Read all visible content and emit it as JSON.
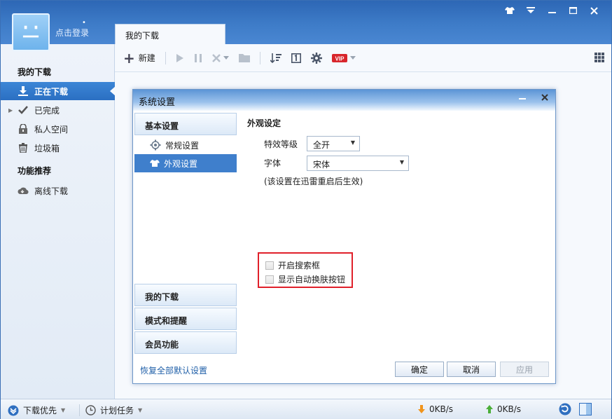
{
  "header": {
    "login_text": "点击登录",
    "tab_label": "我的下载",
    "window_controls": [
      "skin-icon",
      "menu-icon",
      "minimize-icon",
      "maximize-icon",
      "close-icon"
    ]
  },
  "sidebar": {
    "section1": "我的下载",
    "items": [
      {
        "label": "正在下载",
        "icon": "download-icon",
        "active": true
      },
      {
        "label": "已完成",
        "icon": "check-icon"
      },
      {
        "label": "私人空间",
        "icon": "lock-icon"
      },
      {
        "label": "垃圾箱",
        "icon": "trash-icon"
      }
    ],
    "section2": "功能推荐",
    "items2": [
      {
        "label": "离线下载",
        "icon": "cloud-icon"
      }
    ]
  },
  "toolbar": {
    "new_label": "新建"
  },
  "dialog": {
    "title": "系统设置",
    "categories": {
      "basic": "基本设置",
      "sub_general": "常规设置",
      "sub_appearance": "外观设置",
      "my_download": "我的下载",
      "mode": "模式和提醒",
      "vip": "会员功能"
    },
    "restore_link": "恢复全部默认设置",
    "appearance": {
      "heading": "外观设定",
      "effect_label": "特效等级",
      "effect_value": "全开",
      "font_label": "字体",
      "font_value": "宋体",
      "note": "(该设置在迅雷重启后生效)",
      "checkbox1": "开启搜索框",
      "checkbox2": "显示自动换肤按钮"
    },
    "buttons": {
      "ok": "确定",
      "cancel": "取消",
      "apply": "应用"
    }
  },
  "statusbar": {
    "priority": "下载优先",
    "schedule": "计划任务",
    "down_speed": "0KB/s",
    "up_speed": "0KB/s"
  },
  "colors": {
    "accent": "#2b6fc2",
    "highlight": "#e0202a"
  }
}
